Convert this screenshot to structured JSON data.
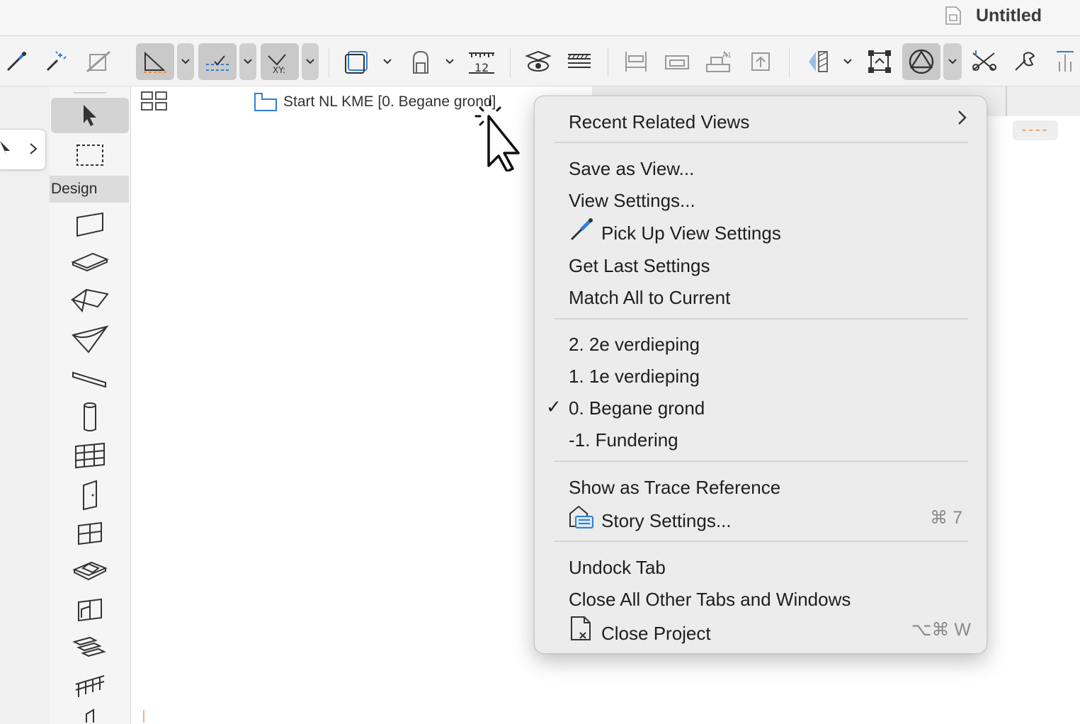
{
  "window": {
    "title": "Untitled"
  },
  "left_panel": {
    "design_label": "Design"
  },
  "tab": {
    "title": "Start NL KME [0. Begane grond]"
  },
  "canvas": {
    "dashes": "----"
  },
  "context_menu": {
    "recent_related_views": "Recent Related Views",
    "save_as_view": "Save as View...",
    "view_settings": "View Settings...",
    "pick_up_view_settings": "Pick Up View Settings",
    "get_last_settings": "Get Last Settings",
    "match_all_to_current": "Match All to Current",
    "stories": [
      {
        "label": "2. 2e verdieping",
        "checked": false
      },
      {
        "label": "1. 1e verdieping",
        "checked": false
      },
      {
        "label": "0. Begane grond",
        "checked": true
      },
      {
        "label": "-1. Fundering",
        "checked": false
      }
    ],
    "check_mark": "✓",
    "show_as_trace_reference": "Show as Trace Reference",
    "story_settings": "Story Settings...",
    "story_settings_shortcut": "⌘ 7",
    "undock_tab": "Undock Tab",
    "close_all_other": "Close All Other Tabs and Windows",
    "close_project": "Close Project",
    "close_project_shortcut": "⌥⌘ W"
  },
  "colors": {
    "accent_blue": "#2f7fd6",
    "orange": "#f08a3c",
    "menu_bg": "#ececec"
  }
}
